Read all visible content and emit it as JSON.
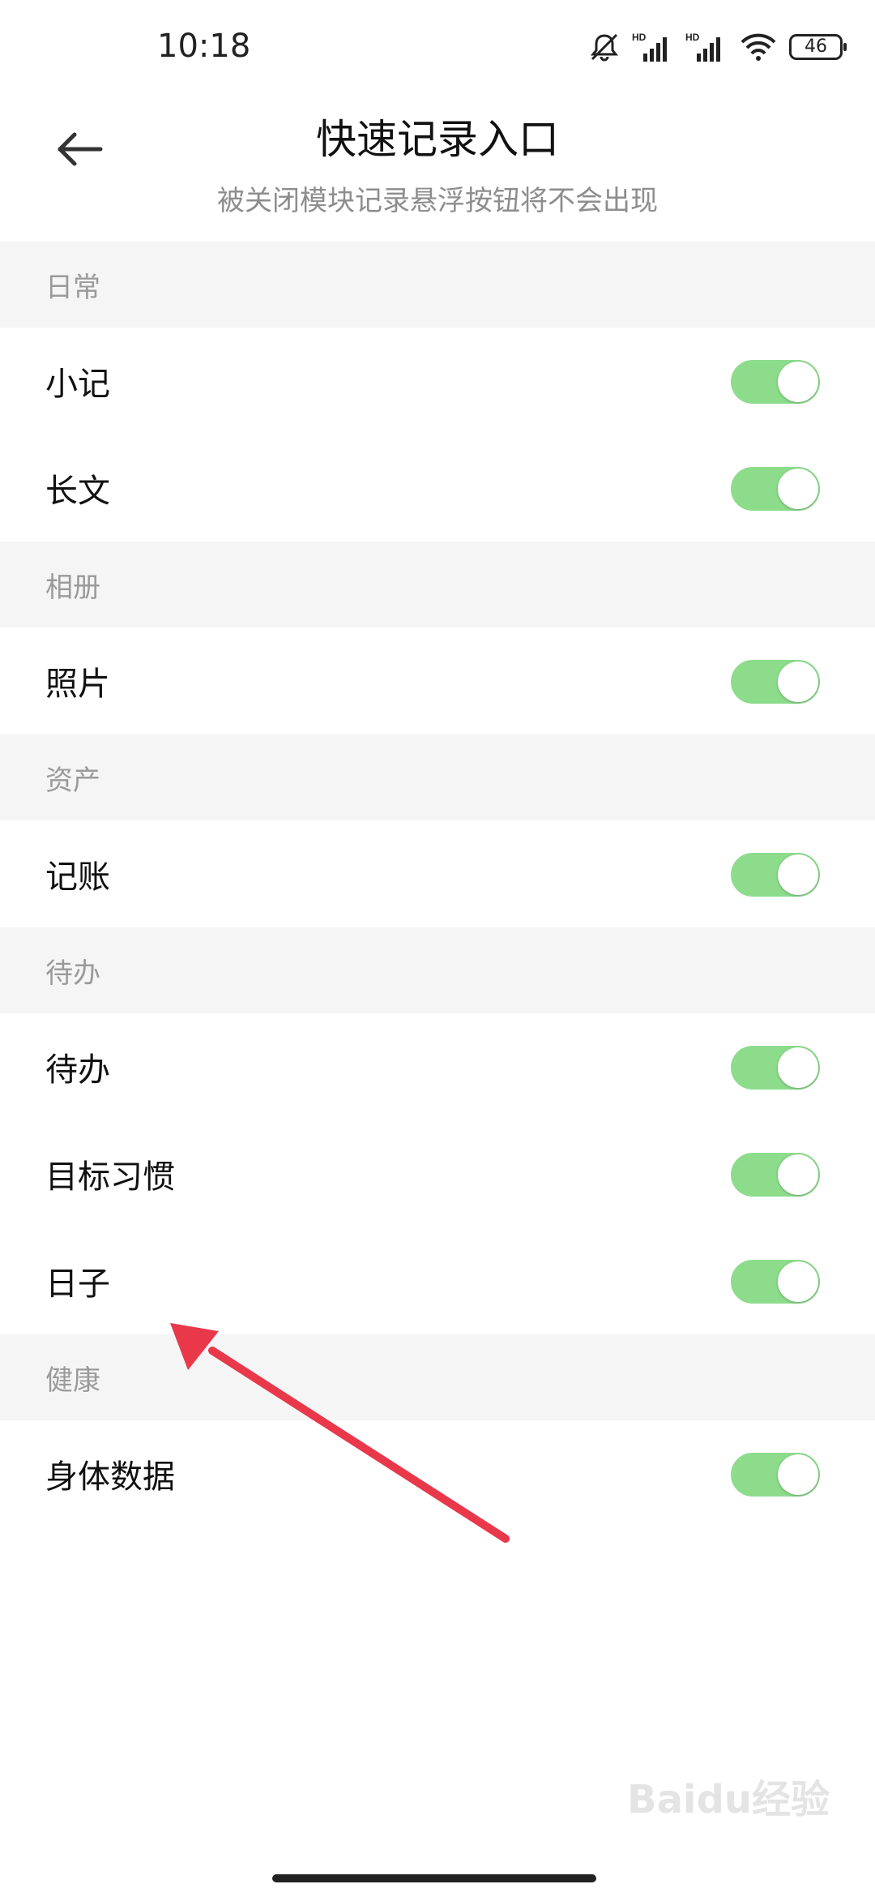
{
  "status_bar": {
    "time": "10:18",
    "battery": "46",
    "icons": [
      "mute-bell-icon",
      "hd-signal-icon",
      "hd-signal-icon",
      "wifi-icon",
      "battery-icon"
    ]
  },
  "header": {
    "back_icon": "arrow-left-icon",
    "title": "快速记录入口",
    "subtitle": "被关闭模块记录悬浮按钮将不会出现"
  },
  "sections": [
    {
      "title": "日常",
      "items": [
        {
          "label": "小记",
          "enabled": true
        },
        {
          "label": "长文",
          "enabled": true
        }
      ]
    },
    {
      "title": "相册",
      "items": [
        {
          "label": "照片",
          "enabled": true
        }
      ]
    },
    {
      "title": "资产",
      "items": [
        {
          "label": "记账",
          "enabled": true
        }
      ]
    },
    {
      "title": "待办",
      "items": [
        {
          "label": "待办",
          "enabled": true
        },
        {
          "label": "目标习惯",
          "enabled": true
        },
        {
          "label": "日子",
          "enabled": true
        }
      ]
    },
    {
      "title": "健康",
      "items": [
        {
          "label": "身体数据",
          "enabled": true
        }
      ]
    }
  ],
  "colors": {
    "toggle_on": "#8cdc8c",
    "section_bg": "#f5f5f5",
    "arrow": "#e8384a"
  },
  "watermark": "Baidu经验"
}
